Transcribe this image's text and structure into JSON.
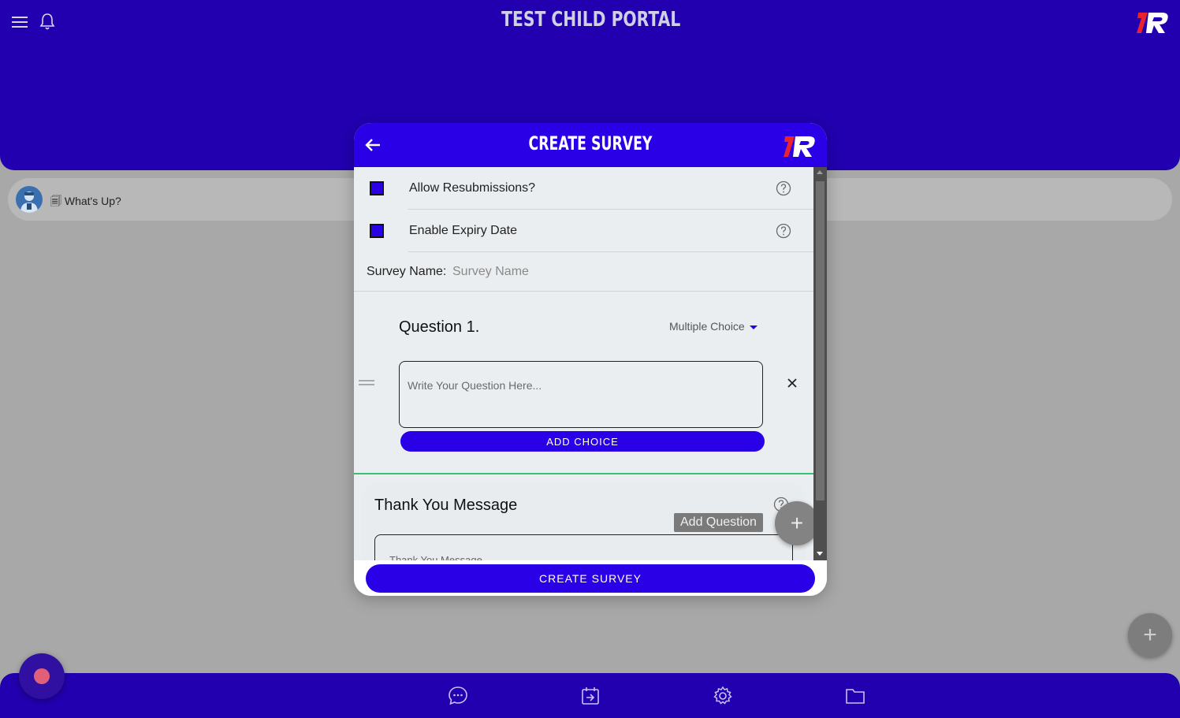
{
  "app": {
    "title": "TEST CHILD PORTAL",
    "status_text": "🗐 What's Up?",
    "bg_fab_label": "+"
  },
  "modal": {
    "title": "CREATE SURVEY",
    "options": [
      {
        "label": "Allow Resubmissions?",
        "checked": true
      },
      {
        "label": "Enable Expiry Date",
        "checked": true
      }
    ],
    "survey_name": {
      "label": "Survey Name:",
      "placeholder": "Survey Name",
      "value": ""
    },
    "question": {
      "title": "Question 1.",
      "type": "Multiple Choice",
      "placeholder": "Write Your Question Here...",
      "add_choice_label": "ADD CHOICE"
    },
    "thank_you": {
      "title": "Thank You Message",
      "placeholder": "Thank You Message"
    },
    "add_question_tooltip": "Add Question",
    "add_question_fab": "+",
    "create_button_label": "CREATE SURVEY"
  },
  "colors": {
    "header_bg": "#2200b0",
    "modal_accent": "#2a00e6",
    "divider_green": "#38c170",
    "overlay_bg": "#a8a8a8"
  },
  "icons": [
    "menu-icon",
    "bell-icon",
    "brand-logo",
    "back-arrow-icon",
    "help-icon",
    "close-icon",
    "drag-handle-icon",
    "chat-icon",
    "calendar-export-icon",
    "settings-icon",
    "folder-icon",
    "record-icon",
    "plus-icon"
  ]
}
